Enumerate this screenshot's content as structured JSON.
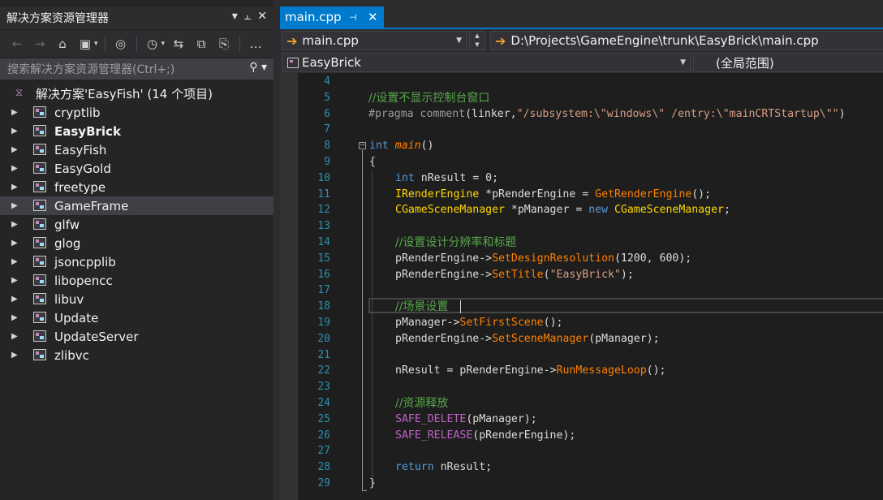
{
  "solution_explorer": {
    "title": "解决方案资源管理器",
    "title_buttons": [
      "▾",
      "📌",
      "✕"
    ],
    "search_placeholder": "搜索解决方案资源管理器(Ctrl+;)",
    "solution_label": "解决方案'EasyFish' (14 个项目)",
    "projects": [
      {
        "label": "cryptlib"
      },
      {
        "label": "EasyBrick",
        "bold": true
      },
      {
        "label": "EasyFish"
      },
      {
        "label": "EasyGold"
      },
      {
        "label": "freetype"
      },
      {
        "label": "GameFrame",
        "selected": true
      },
      {
        "label": "glfw"
      },
      {
        "label": "glog"
      },
      {
        "label": "jsoncpplib"
      },
      {
        "label": "libopencc"
      },
      {
        "label": "libuv"
      },
      {
        "label": "Update"
      },
      {
        "label": "UpdateServer"
      },
      {
        "label": "zlibvc"
      }
    ]
  },
  "editor": {
    "tab": {
      "name": "main.cpp",
      "pin": "⊣",
      "close": "✕"
    },
    "file_dropdown": "main.cpp",
    "file_path": "D:\\Projects\\GameEngine\\trunk\\EasyBrick\\main.cpp",
    "project_dropdown": "EasyBrick",
    "scope_dropdown": "(全局范围)",
    "line_numbers": [
      "4",
      "5",
      "6",
      "7",
      "8",
      "9",
      "10",
      "11",
      "12",
      "13",
      "14",
      "15",
      "16",
      "17",
      "18",
      "19",
      "20",
      "21",
      "22",
      "23",
      "24",
      "25",
      "26",
      "27",
      "28",
      "29"
    ],
    "code": {
      "l5": "//设置不显示控制台窗口",
      "l6a": "#pragma comment",
      "l6b": "(linker,",
      "l6c": "\"/subsystem:\\\"windows\\\" /entry:\\\"mainCRTStartup\\\"\"",
      "l6d": ")",
      "l8a": "int",
      "l8b": " main",
      "l8c": "()",
      "l9": "{",
      "l10a": "int",
      "l10b": " nResult = 0;",
      "l11a": "IRenderEngine",
      "l11b": " *pRenderEngine = ",
      "l11c": "GetRenderEngine",
      "l11d": "();",
      "l12a": "CGameSceneManager",
      "l12b": " *pManager = ",
      "l12c": "new",
      "l12d": " CGameSceneManager",
      "l12e": ";",
      "l14": "//设置设计分辨率和标题",
      "l15a": "pRenderEngine->",
      "l15b": "SetDesignResolution",
      "l15c": "(1200, 600);",
      "l16a": "pRenderEngine->",
      "l16b": "SetTitle",
      "l16c": "(",
      "l16d": "\"EasyBrick\"",
      "l16e": ");",
      "l18": "//场景设置",
      "l19a": "pManager->",
      "l19b": "SetFirstScene",
      "l19c": "();",
      "l20a": "pRenderEngine->",
      "l20b": "SetSceneManager",
      "l20c": "(pManager);",
      "l22a": "nResult = pRenderEngine->",
      "l22b": "RunMessageLoop",
      "l22c": "();",
      "l24": "//资源释放",
      "l25a": "SAFE_DELETE",
      "l25b": "(pManager);",
      "l26a": "SAFE_RELEASE",
      "l26b": "(pRenderEngine);",
      "l28a": "return",
      "l28b": " nResult;",
      "l29": "}"
    }
  }
}
